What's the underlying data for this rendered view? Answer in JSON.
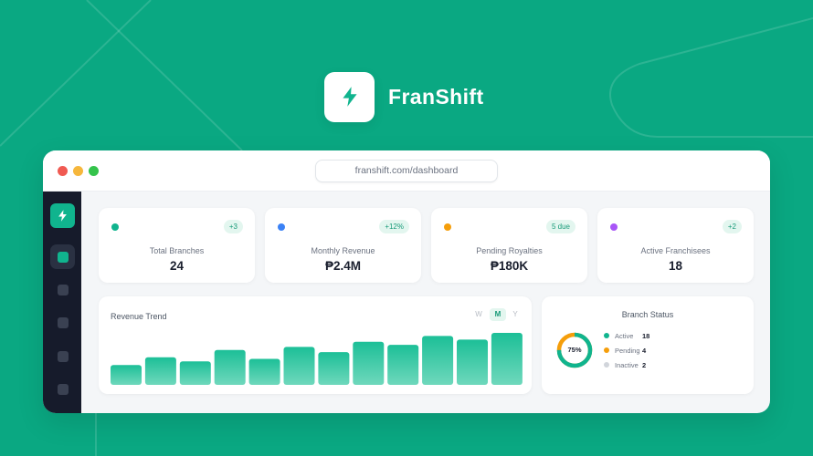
{
  "brand": {
    "name": "FranShift",
    "icon": "lightning-bolt-icon"
  },
  "browser": {
    "url": "franshift.com/dashboard"
  },
  "sidebar": {
    "logo_icon": "lightning-bolt-icon",
    "items": [
      {
        "name": "dashboard",
        "active": true
      },
      {
        "name": "item-2",
        "active": false
      },
      {
        "name": "item-3",
        "active": false
      },
      {
        "name": "item-4",
        "active": false
      },
      {
        "name": "item-5",
        "active": false
      }
    ]
  },
  "stats": [
    {
      "label": "Total Branches",
      "value": "24",
      "badge": "+3",
      "color": "#10b48e"
    },
    {
      "label": "Monthly Revenue",
      "value": "₱2.4M",
      "badge": "+12%",
      "color": "#3b82f6"
    },
    {
      "label": "Pending Royalties",
      "value": "₱180K",
      "badge": "5 due",
      "color": "#f59e0b"
    },
    {
      "label": "Active Franchisees",
      "value": "18",
      "badge": "+2",
      "color": "#a855f7"
    }
  ],
  "revenue": {
    "title": "Revenue Trend",
    "periods": [
      "W",
      "M",
      "Y"
    ],
    "selected_period": "M"
  },
  "chart_data": {
    "type": "bar",
    "values": [
      0.38,
      0.53,
      0.45,
      0.67,
      0.5,
      0.73,
      0.63,
      0.83,
      0.77,
      0.94,
      0.87,
      1.0
    ],
    "title": "Revenue Trend",
    "ylim": [
      0,
      1
    ]
  },
  "branch_status": {
    "title": "Branch Status",
    "percent_label": "75%",
    "active_fraction": 0.75,
    "items": [
      {
        "label": "Active",
        "count": "18",
        "color": "#10b48e"
      },
      {
        "label": "Pending",
        "count": "4",
        "color": "#f59e0b"
      },
      {
        "label": "Inactive",
        "count": "2",
        "color": "#d1d5db"
      }
    ]
  },
  "colors": {
    "background": "#0aa882",
    "accent": "#10b48e",
    "sidebar": "#161b2b"
  }
}
